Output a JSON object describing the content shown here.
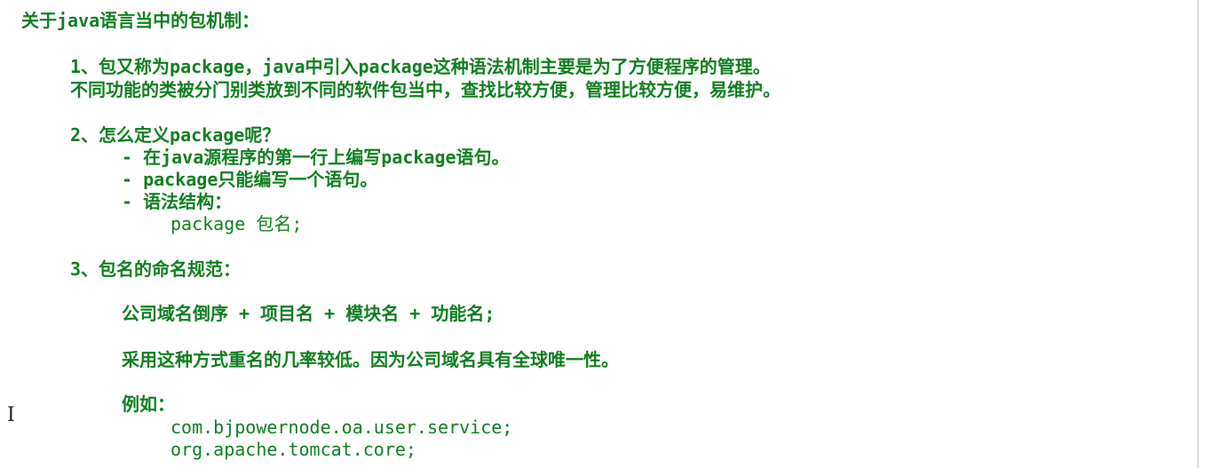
{
  "document": {
    "title": "关于java语言当中的包机制：",
    "section1": {
      "line1": "1、包又称为package，java中引入package这种语法机制主要是为了方便程序的管理。",
      "line2": "不同功能的类被分门别类放到不同的软件包当中，查找比较方便，管理比较方便，易维护。"
    },
    "section2": {
      "heading": "2、怎么定义package呢？",
      "bullet1": "- 在java源程序的第一行上编写package语句。",
      "bullet2": "- package只能编写一个语句。",
      "bullet3": "- 语法结构：",
      "syntax": "package 包名;"
    },
    "section3": {
      "heading": "3、包名的命名规范：",
      "rule": "公司域名倒序 + 项目名 + 模块名 + 功能名;",
      "reason": "采用这种方式重名的几率较低。因为公司域名具有全球唯一性。",
      "example_label": "例如：",
      "example1": "com.bjpowernode.oa.user.service;",
      "example2": "org.apache.tomcat.core;"
    }
  },
  "ui": {
    "text_cursor_icon": "text-cursor-icon"
  }
}
